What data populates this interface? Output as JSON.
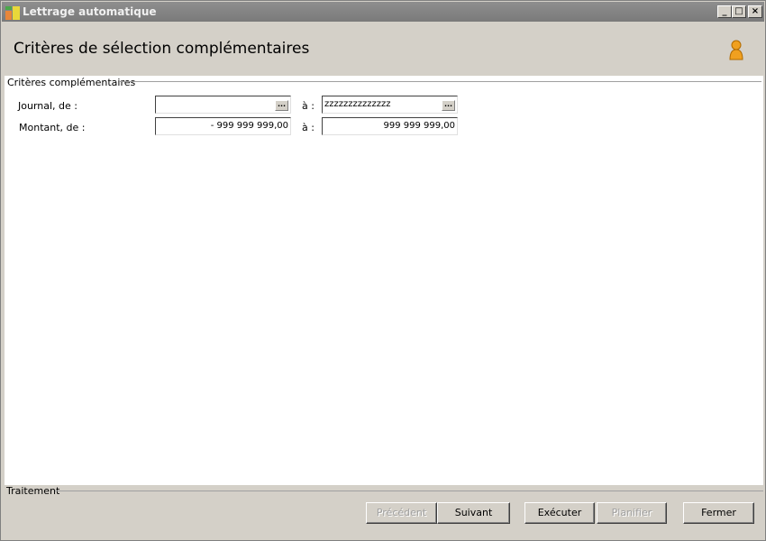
{
  "window": {
    "title": "Lettrage automatique",
    "minimize": "_",
    "maximize": "□",
    "close": "×"
  },
  "header": {
    "title": "Critères de sélection complémentaires",
    "user_icon": "user-icon"
  },
  "criteria": {
    "group_label": "Critères complémentaires",
    "journal": {
      "label": "Journal, de :",
      "from_value": "",
      "to_label": "à :",
      "to_value": "zzzzzzzzzzzzzz",
      "browse_label": "..."
    },
    "montant": {
      "label": "Montant, de :",
      "from_value": "- 999 999 999,00",
      "to_label": "à :",
      "to_value": "999 999 999,00"
    }
  },
  "footer": {
    "group_label": "Traitement",
    "buttons": {
      "previous": "Précédent",
      "next": "Suivant",
      "execute": "Exécuter",
      "schedule": "Planifier",
      "close": "Fermer"
    }
  }
}
